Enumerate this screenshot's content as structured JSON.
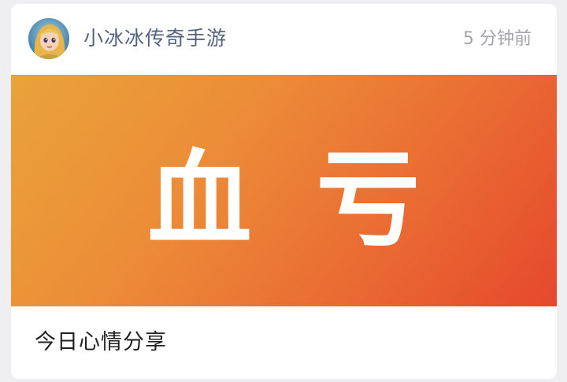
{
  "post": {
    "account_name": "小冰冰传奇手游",
    "time": "5 分钟前",
    "banner_text": "血亏",
    "caption": "今日心情分享",
    "avatar": "cartoon-blonde-girl-avatar"
  },
  "colors": {
    "banner_gradient_start": "#eaa33a",
    "banner_gradient_end": "#e5482c",
    "account_name": "#55637f",
    "time": "#a4a4a8"
  }
}
